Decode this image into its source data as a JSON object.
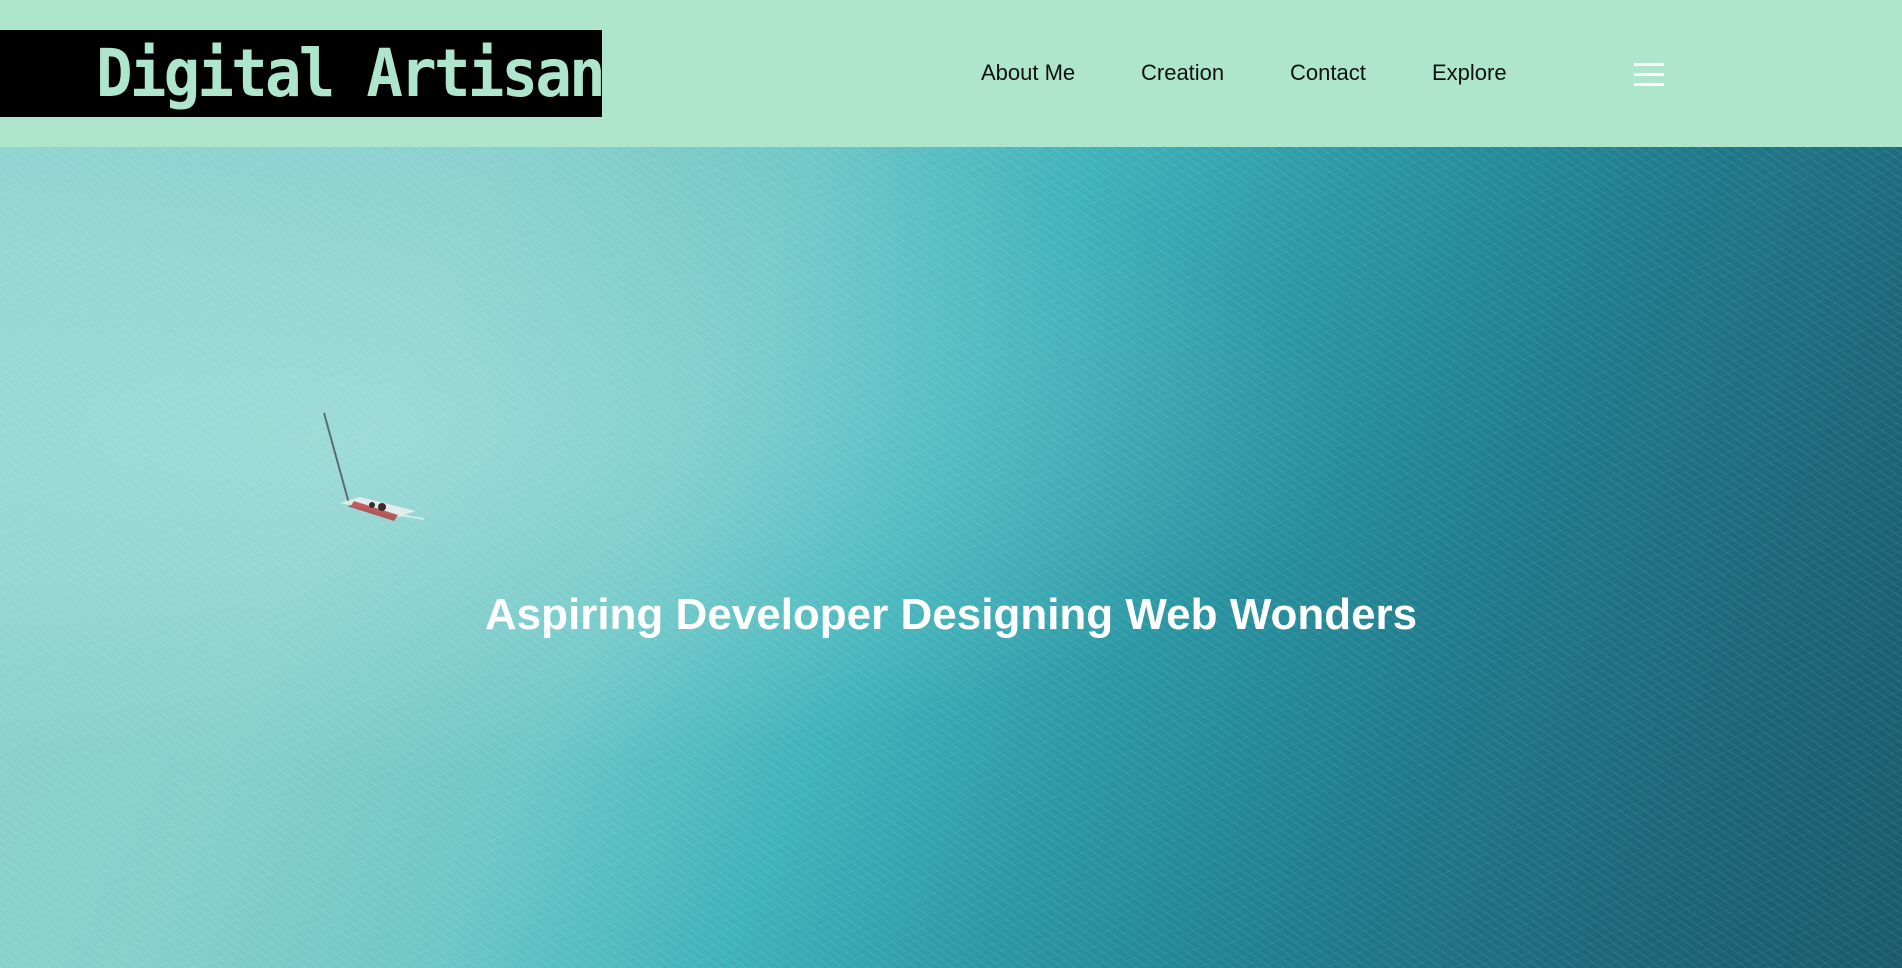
{
  "header": {
    "logo_text": "Digital Artisan Jess",
    "nav": {
      "about": "About Me",
      "creation": "Creation",
      "contact": "Contact",
      "explore": "Explore"
    },
    "menu_icon": "hamburger-menu-icon"
  },
  "hero": {
    "title": "Aspiring Developer Designing Web Wonders",
    "background": "aerial ocean with sailboat"
  },
  "colors": {
    "header_bg": "#ade6cc",
    "logo_bg": "#000000",
    "logo_text": "#ade6cc",
    "nav_text": "#111111",
    "hero_text": "#ffffff"
  }
}
